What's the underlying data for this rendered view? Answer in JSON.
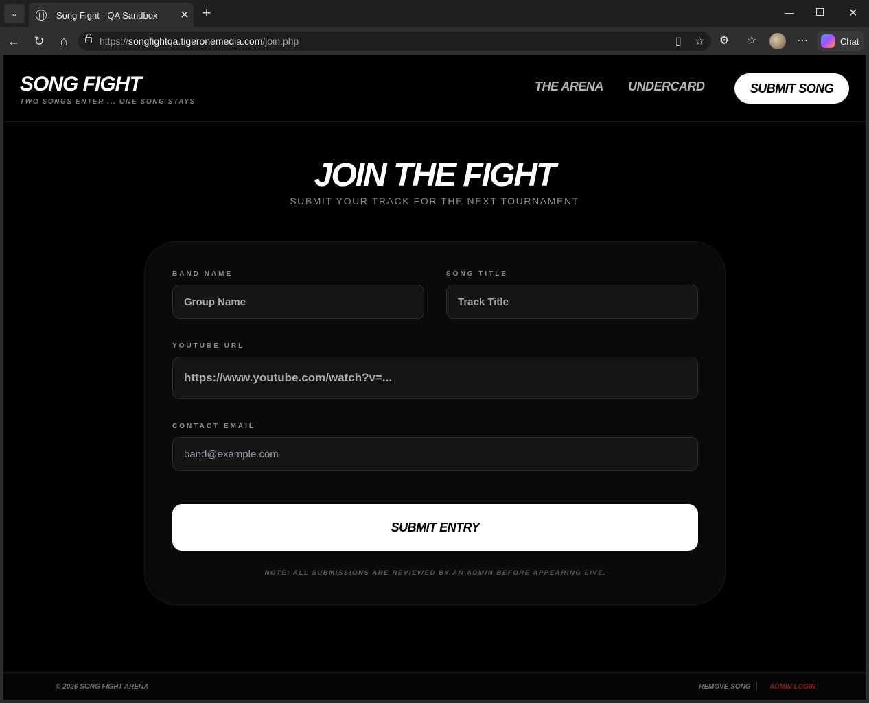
{
  "browser": {
    "tab_title": "Song Fight - QA Sandbox",
    "url_prefix": "https://",
    "url_host": "songfightqa.tigeronemedia.com",
    "url_path": "/join.php",
    "chat_label": "Chat"
  },
  "header": {
    "logo": "SONG FIGHT",
    "tagline": "TWO SONGS ENTER ... ONE SONG STAYS",
    "nav": [
      "THE ARENA",
      "UNDERCARD"
    ],
    "cta": "SUBMIT SONG"
  },
  "hero": {
    "title": "JOIN THE FIGHT",
    "subtitle": "SUBMIT YOUR TRACK FOR THE NEXT TOURNAMENT"
  },
  "form": {
    "band_label": "BAND NAME",
    "band_placeholder": "Group Name",
    "song_label": "SONG TITLE",
    "song_placeholder": "Track Title",
    "youtube_label": "YOUTUBE URL",
    "youtube_placeholder": "https://www.youtube.com/watch?v=...",
    "email_label": "CONTACT EMAIL",
    "email_placeholder": "band@example.com",
    "submit_label": "SUBMIT ENTRY",
    "note": "NOTE: ALL SUBMISSIONS ARE REVIEWED BY AN ADMIN BEFORE APPEARING LIVE."
  },
  "footer": {
    "copyright": "© 2026 SONG FIGHT ARENA",
    "remove": "REMOVE SONG",
    "separator": "|",
    "admin": "ADMIN LOGIN",
    "admin_color": "#8b1c1c"
  }
}
